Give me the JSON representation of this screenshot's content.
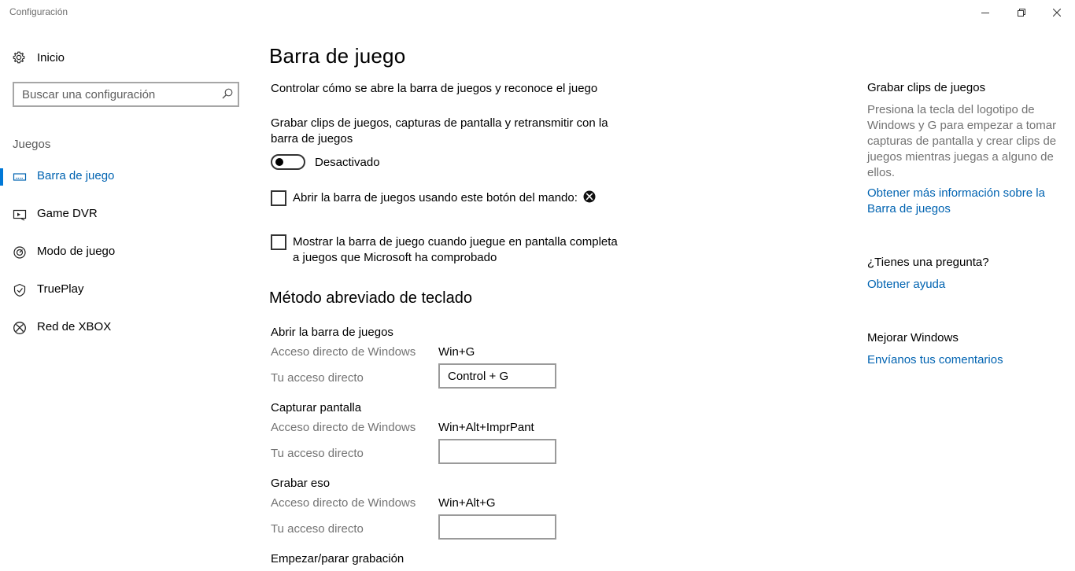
{
  "window": {
    "title": "Configuración"
  },
  "sidebar": {
    "home_label": "Inicio",
    "search_placeholder": "Buscar una configuración",
    "section_title": "Juegos",
    "items": [
      {
        "label": "Barra de juego",
        "icon": "game-bar-icon",
        "active": true
      },
      {
        "label": "Game DVR",
        "icon": "game-dvr-icon",
        "active": false
      },
      {
        "label": "Modo de juego",
        "icon": "game-mode-icon",
        "active": false
      },
      {
        "label": "TruePlay",
        "icon": "trueplay-icon",
        "active": false
      },
      {
        "label": "Red de XBOX",
        "icon": "xbox-icon",
        "active": false
      }
    ]
  },
  "main": {
    "title": "Barra de juego",
    "intro": "Controlar cómo se abre la barra de juegos y reconoce el juego",
    "record_setting_label_line1": "Grabar clips de juegos, capturas de pantalla y retransmitir con la",
    "record_setting_label_line2": "barra de juegos",
    "toggle_state": "Desactivado",
    "toggle_on": false,
    "checkbox1_label": "Abrir la barra de juegos usando este botón del mando:",
    "checkbox1_checked": false,
    "checkbox2_label_line1": "Mostrar la barra de juego cuando juegue en pantalla completa",
    "checkbox2_label_line2": "a juegos que Microsoft ha comprobado",
    "checkbox2_checked": false,
    "shortcuts_title": "Método abreviado de teclado",
    "shortcuts": [
      {
        "name": "Abrir la barra de juegos",
        "windows_label": "Acceso directo de Windows",
        "windows_value": "Win+G",
        "custom_label": "Tu acceso directo",
        "custom_value": "Control + G"
      },
      {
        "name": "Capturar pantalla",
        "windows_label": "Acceso directo de Windows",
        "windows_value": "Win+Alt+ImprPant",
        "custom_label": "Tu acceso directo",
        "custom_value": ""
      },
      {
        "name": "Grabar eso",
        "windows_label": "Acceso directo de Windows",
        "windows_value": "Win+Alt+G",
        "custom_label": "Tu acceso directo",
        "custom_value": ""
      },
      {
        "name": "Empezar/parar grabación"
      }
    ]
  },
  "right": {
    "section1_title": "Grabar clips de juegos",
    "section1_desc_lines": [
      "Presiona la tecla del logotipo de",
      "Windows y G para empezar a tomar",
      "capturas de pantalla y crear clips de",
      "juegos mientras juegas a alguno de",
      "ellos."
    ],
    "section1_link_line1": "Obtener más información sobre la",
    "section1_link_line2": "Barra de juegos",
    "section2_title": "¿Tienes una pregunta?",
    "section2_link": "Obtener ayuda",
    "section3_title": "Mejorar Windows",
    "section3_link": "Envíanos tus comentarios"
  },
  "colors": {
    "accent": "#0078d7",
    "link": "#0063b1",
    "secondary_text": "#737373"
  }
}
